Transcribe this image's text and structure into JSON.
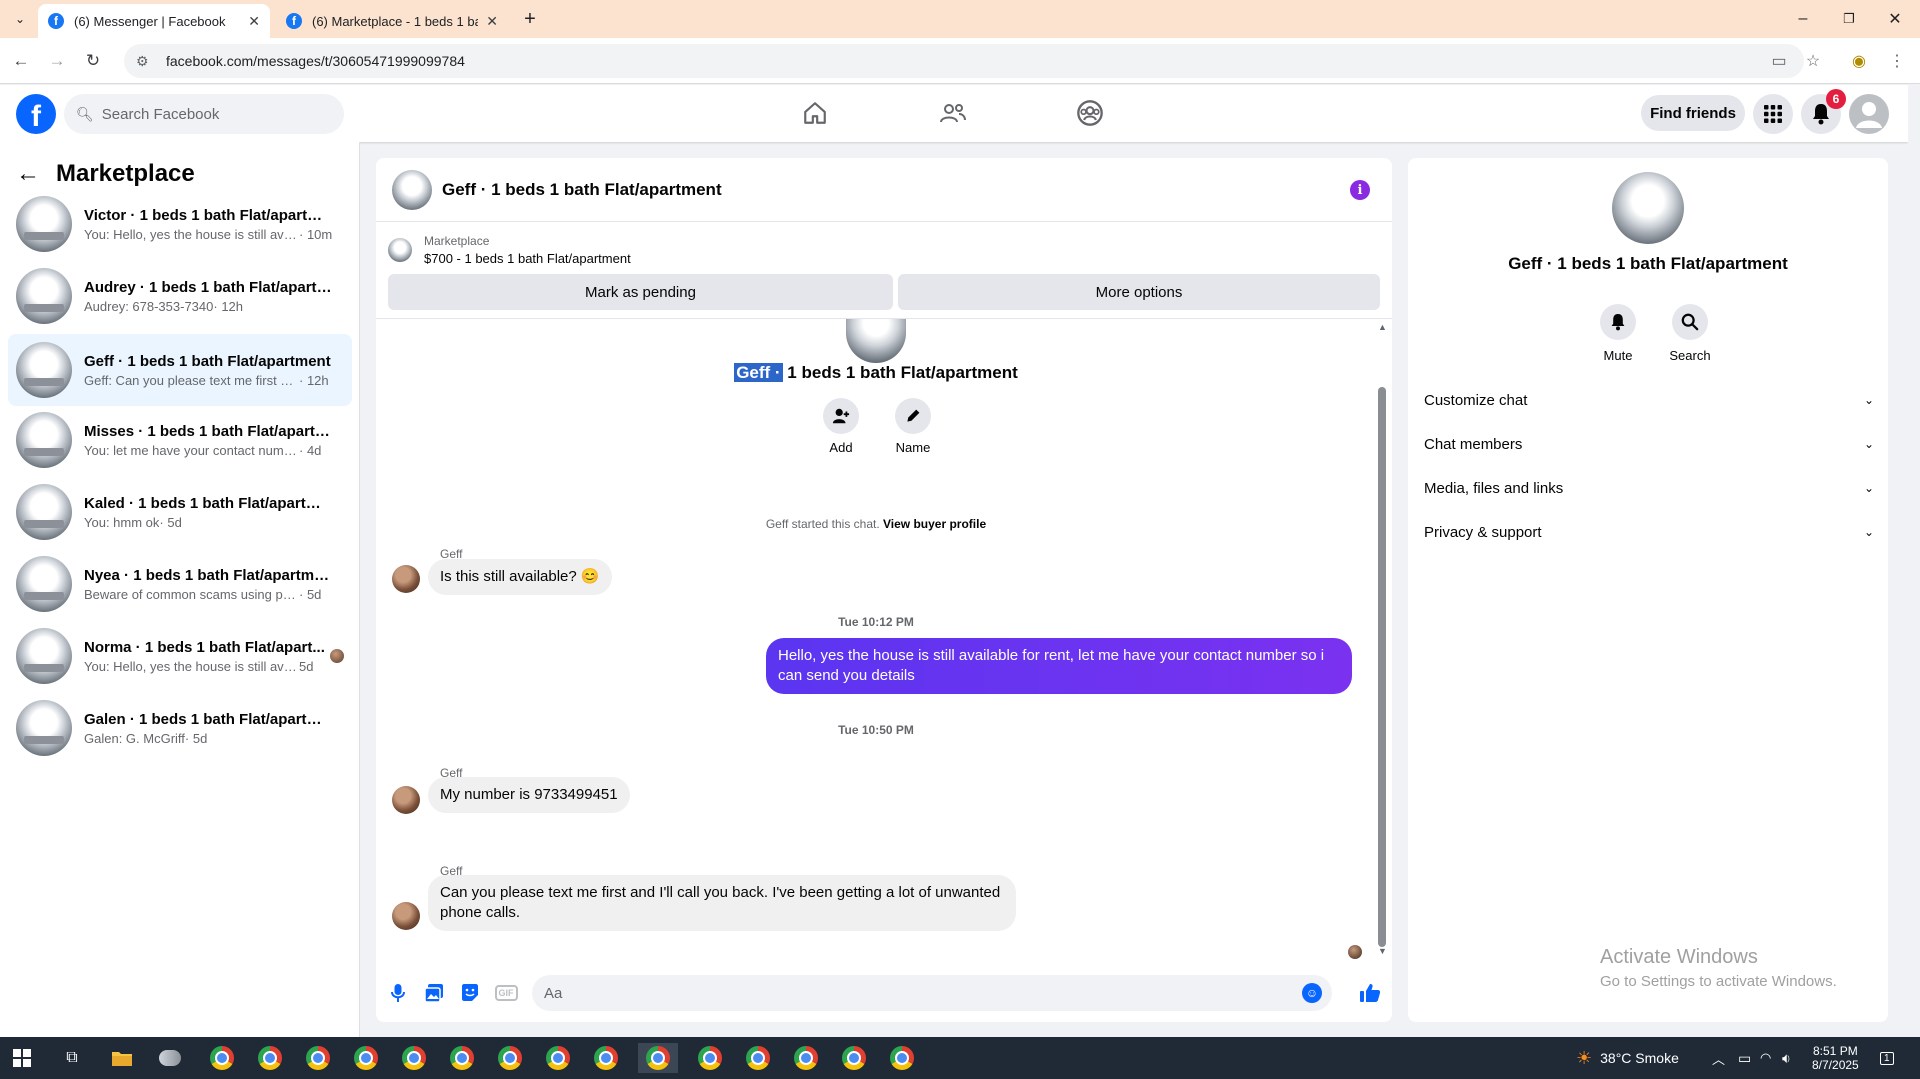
{
  "browser": {
    "tabs": [
      {
        "title": "(6) Messenger | Facebook",
        "active": true
      },
      {
        "title": "(6) Marketplace - 1 beds 1 bath",
        "active": false
      }
    ],
    "url": "facebook.com/messages/t/30605471999099784"
  },
  "header": {
    "search_placeholder": "Search Facebook",
    "find_friends": "Find friends",
    "notification_count": "6"
  },
  "sidebar": {
    "title": "Marketplace",
    "conversations": [
      {
        "name": "Victor · 1 beds 1 bath Flat/apartment",
        "preview": "You: Hello, yes the house is still avail...",
        "time": " · 10m",
        "selected": false
      },
      {
        "name": "Audrey · 1 beds 1 bath Flat/apartm...",
        "preview": "Audrey: 678-353-7340",
        "time": " · 12h",
        "selected": false
      },
      {
        "name": "Geff · 1 beds 1 bath Flat/apartment",
        "preview": "Geff: Can you please text me first an...",
        "time": " · 12h",
        "selected": true
      },
      {
        "name": "Misses · 1 beds 1 bath Flat/apartm...",
        "preview": "You: let me have your contact number...",
        "time": " · 4d",
        "selected": false
      },
      {
        "name": "Kaled · 1 beds 1 bath Flat/apartment",
        "preview": "You: hmm ok",
        "time": " · 5d",
        "selected": false
      },
      {
        "name": "Nyea · 1 beds 1 bath Flat/apartment",
        "preview": "Beware of common scams using pay...",
        "time": " · 5d",
        "selected": false
      },
      {
        "name": "Norma · 1 beds 1 bath Flat/apart...",
        "preview": "You: Hello, yes the house is still ava...",
        "time": " 5d",
        "selected": false
      },
      {
        "name": "Galen · 1 beds 1 bath Flat/apartment",
        "preview": "Galen: G. McGriff",
        "time": " · 5d",
        "selected": false
      }
    ]
  },
  "chat": {
    "title": "Geff · 1 beds 1 bath Flat/apartment",
    "listing_category": "Marketplace",
    "listing_price": "$700 - 1 beds 1 bath Flat/apartment",
    "mark_pending": "Mark as pending",
    "more_options": "More options",
    "mid_title_highlight": "Geff ·",
    "mid_title_rest": " 1 beds 1 bath Flat/apartment",
    "add_label": "Add",
    "name_label": "Name",
    "started_text": "Geff started this chat. ",
    "view_buyer": "View buyer profile",
    "messages": [
      {
        "sender": "Geff",
        "text": "Is this still available? 😊"
      },
      {
        "timestamp": "Tue 10:12 PM"
      },
      {
        "out": "Hello, yes the house is still available for rent, let me have your contact number so i can send you details"
      },
      {
        "timestamp": "Tue 10:50 PM"
      },
      {
        "sender": "Geff",
        "text": "My number is 9733499451"
      },
      {
        "sender": "Geff",
        "text": "Can you please text me first and I'll call you back. I've been getting a lot of unwanted phone calls."
      }
    ],
    "composer_placeholder": "Aa",
    "gif_label": "GIF"
  },
  "info_panel": {
    "title": "Geff · 1 beds 1 bath Flat/apartment",
    "mute": "Mute",
    "search": "Search",
    "sections": [
      "Customize chat",
      "Chat members",
      "Media, files and links",
      "Privacy & support"
    ]
  },
  "watermark": {
    "line1": "Activate Windows",
    "line2": "Go to Settings to activate Windows."
  },
  "taskbar": {
    "weather": "38°C  Smoke",
    "time": "8:51 PM",
    "date": "8/7/2025",
    "notifications": "1"
  },
  "colors": {
    "fb_blue": "#0866ff",
    "outgoing_bubble": "#5b35f0",
    "selected_conv": "#ebf5ff",
    "info_purple": "#8a2be2"
  }
}
